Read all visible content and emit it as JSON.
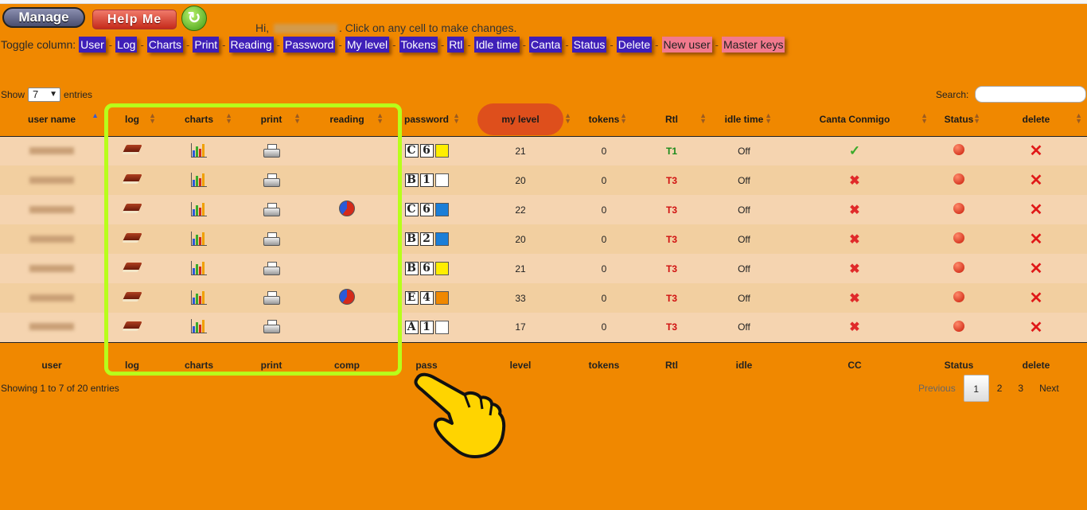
{
  "header": {
    "manage_label": "Manage",
    "help_label": "Help Me",
    "refresh_icon": "↻",
    "greeting_prefix": "Hi,",
    "greeting_suffix": ". Click on any cell to make changes."
  },
  "toggle": {
    "label": "Toggle column:",
    "dash": "-",
    "items": [
      "User",
      "Log",
      "Charts",
      "Print",
      "Reading",
      "Password",
      "My level",
      "Tokens",
      "Rtl",
      "Idle time",
      "Canta",
      "Status",
      "Delete",
      "New user",
      "Master keys"
    ]
  },
  "controls": {
    "show_label": "Show",
    "entries_value": "7",
    "entries_label": "entries",
    "search_label": "Search:",
    "search_value": ""
  },
  "table": {
    "headers": [
      "user name",
      "log",
      "charts",
      "print",
      "reading",
      "password",
      "my level",
      "tokens",
      "Rtl",
      "idle time",
      "Canta Conmigo",
      "Status",
      "delete"
    ],
    "footers": [
      "user",
      "log",
      "charts",
      "print",
      "comp",
      "pass",
      "level",
      "tokens",
      "Rtl",
      "idle",
      "CC",
      "Status",
      "delete"
    ],
    "rows": [
      {
        "pw": [
          "C",
          "6"
        ],
        "pw_color": "#ffee00",
        "pie": false,
        "level": "21",
        "tokens": "0",
        "rtl": "T1",
        "idle": "Off",
        "canta": "check"
      },
      {
        "pw": [
          "B",
          "1"
        ],
        "pw_color": "#ffffff",
        "pie": false,
        "level": "20",
        "tokens": "0",
        "rtl": "T3",
        "idle": "Off",
        "canta": "x"
      },
      {
        "pw": [
          "C",
          "6"
        ],
        "pw_color": "#1a7ed8",
        "pie": true,
        "level": "22",
        "tokens": "0",
        "rtl": "T3",
        "idle": "Off",
        "canta": "x"
      },
      {
        "pw": [
          "B",
          "2"
        ],
        "pw_color": "#1a7ed8",
        "pie": false,
        "level": "20",
        "tokens": "0",
        "rtl": "T3",
        "idle": "Off",
        "canta": "x"
      },
      {
        "pw": [
          "B",
          "6"
        ],
        "pw_color": "#ffee00",
        "pie": false,
        "level": "21",
        "tokens": "0",
        "rtl": "T3",
        "idle": "Off",
        "canta": "x"
      },
      {
        "pw": [
          "E",
          "4"
        ],
        "pw_color": "#f08800",
        "pie": true,
        "level": "33",
        "tokens": "0",
        "rtl": "T3",
        "idle": "Off",
        "canta": "x"
      },
      {
        "pw": [
          "A",
          "1"
        ],
        "pw_color": "#ffffff",
        "pie": false,
        "level": "17",
        "tokens": "0",
        "rtl": "T3",
        "idle": "Off",
        "canta": "x"
      }
    ]
  },
  "footer": {
    "showing": "Showing 1 to 7 of 20 entries",
    "previous": "Previous",
    "pages": [
      "1",
      "2",
      "3"
    ],
    "next": "Next"
  },
  "icons": {
    "log": "book-icon",
    "charts": "bar-chart-icon",
    "print": "printer-icon",
    "reading": "pie-chart-icon",
    "canta_check": "check-icon",
    "canta_x": "x-icon",
    "status": "red-dot-icon",
    "delete": "delete-x-icon"
  },
  "colors": {
    "background": "#f08800",
    "toggle_button": "#3f1fb8",
    "toggle_pink": "#f27a8e",
    "highlight": "#b8ff1a",
    "rtl_t1": "#1a8a1a",
    "rtl_t3": "#d01010"
  }
}
